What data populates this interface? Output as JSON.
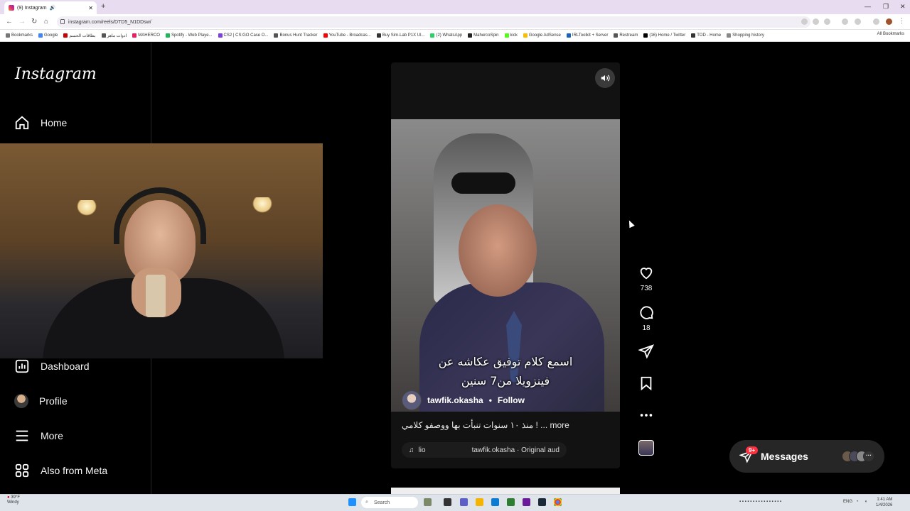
{
  "browser": {
    "tab_title": "(9) Instagram",
    "url": "instagram.com/reels/DTD5_N1DDsw/",
    "bookmarks": [
      "Bookmarks",
      "Google",
      "بطاقات الحسم",
      "ادوات ماهر",
      "MAHERCO",
      "Spotify - Web Playe...",
      "CS2 | CS:GO Case O...",
      "Bonus Hunt Tracker",
      "YouTube - Broadcas...",
      "Buy Sim-Lab P1X Ul...",
      "(2) WhatsApp",
      "MahercoSpin",
      "kick",
      "Google AdSense",
      "IRLToolkit + Server",
      "Restream",
      "(16) Home / Twitter",
      "TOD - Home",
      "Shopping history"
    ],
    "all_bookmarks": "All Bookmarks"
  },
  "instagram": {
    "logo": "Instagram",
    "nav": {
      "home": "Home",
      "dashboard": "Dashboard",
      "profile": "Profile",
      "more": "More",
      "also_from_meta": "Also from Meta"
    },
    "reel": {
      "caption_line1": "اسمع كلام توفيق عكاشه عن",
      "caption_line2": "فينزويلا من7 سنين",
      "username": "tawfik.okasha",
      "separator": "•",
      "follow": "Follow",
      "description": "منذ ١٠ سنوات تنبأت بها ووصفو كلامي ! ... more",
      "audio_start": "lio",
      "audio_label": "tawfik.okasha · Original aud"
    },
    "actions": {
      "likes": "738",
      "comments": "18"
    },
    "messages": {
      "label": "Messages",
      "badge": "9+"
    }
  },
  "taskbar": {
    "weather_temp": "39°F",
    "weather_desc": "Windy",
    "search": "Search",
    "lang": "ENG",
    "time": "1:41 AM",
    "date": "1/4/2026"
  }
}
